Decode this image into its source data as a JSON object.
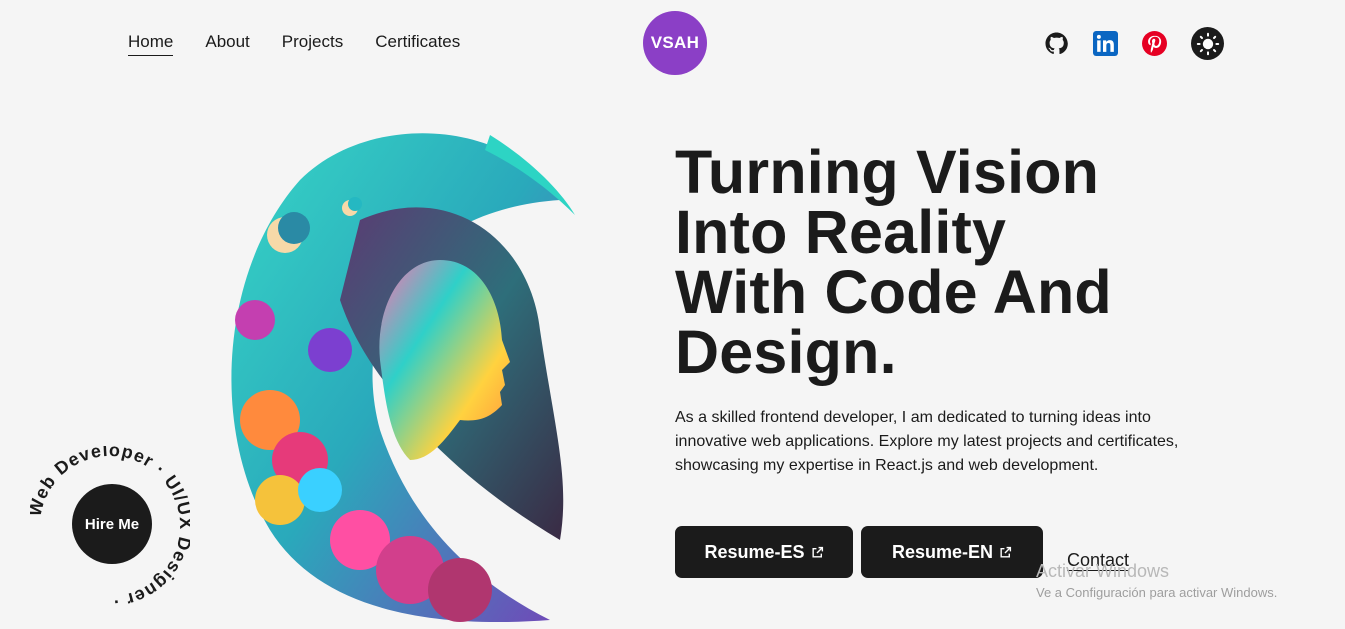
{
  "nav": {
    "items": [
      {
        "label": "Home",
        "active": true
      },
      {
        "label": "About",
        "active": false
      },
      {
        "label": "Projects",
        "active": false
      },
      {
        "label": "Certificates",
        "active": false
      }
    ],
    "logo_text": "VSAH",
    "socials": [
      "github-icon",
      "linkedin-icon",
      "pinterest-icon"
    ],
    "theme_toggle": "sun-icon"
  },
  "hero": {
    "headline_lines": [
      "Turning Vision",
      "Into Reality",
      "With Code And",
      "Design."
    ],
    "intro": "As a skilled frontend developer, I am dedicated to turning ideas into innovative web applications. Explore my latest projects and certificates, showcasing my expertise in React.js and web development.",
    "buttons": [
      {
        "label": "Resume-ES",
        "icon": "external-link-icon"
      },
      {
        "label": "Resume-EN",
        "icon": "external-link-icon"
      }
    ],
    "contact_label": "Contact"
  },
  "hire": {
    "button_label": "Hire Me",
    "ring_text": "Web Developer · UI/UX Designer ·"
  },
  "watermark": {
    "title": "Activar Windows",
    "subtitle": "Ve a Configuración para activar Windows."
  },
  "colors": {
    "logo_bg": "#8b3fc6",
    "text": "#1b1b1b",
    "background": "#f5f5f5",
    "linkedin": "#0a66c2",
    "pinterest": "#e60023"
  }
}
